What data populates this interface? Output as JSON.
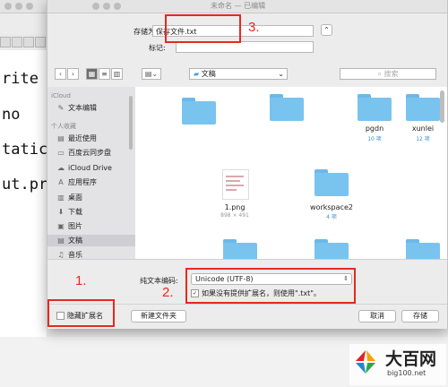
{
  "background_window": {
    "title": "未命名 — 已编辑",
    "toolbar_icons": [
      "format-square-icon",
      "format-square-icon",
      "format-square-icon",
      "format-square-icon"
    ],
    "code_lines": [
      "rite",
      "no",
      "tatic",
      "ut.pri"
    ]
  },
  "dialog": {
    "save_as_label": "存储为:",
    "save_as_value": "保存文件.txt",
    "tags_label": "标记:",
    "tags_value": "",
    "location": "文稿",
    "search_placeholder": "搜索",
    "view_modes": [
      "icon-view",
      "list-view",
      "column-view",
      "gallery-view"
    ],
    "sidebar": {
      "sections": [
        {
          "header": "iCloud",
          "items": [
            {
              "label": "文本编辑",
              "icon": "textedit-icon"
            }
          ]
        },
        {
          "header": "个人收藏",
          "items": [
            {
              "label": "最近使用",
              "icon": "recents-icon"
            },
            {
              "label": "百度云同步盘",
              "icon": "folder-icon"
            },
            {
              "label": "iCloud Drive",
              "icon": "cloud-icon"
            },
            {
              "label": "应用程序",
              "icon": "applications-icon"
            },
            {
              "label": "桌面",
              "icon": "desktop-icon"
            },
            {
              "label": "下载",
              "icon": "downloads-icon"
            },
            {
              "label": "图片",
              "icon": "pictures-icon"
            },
            {
              "label": "文稿",
              "icon": "documents-icon",
              "selected": true
            },
            {
              "label": "音乐",
              "icon": "music-icon"
            }
          ]
        }
      ]
    },
    "files": [
      {
        "name": "",
        "meta": "",
        "type": "folder"
      },
      {
        "name": "",
        "meta": "",
        "type": "folder"
      },
      {
        "name": "pgdn",
        "meta": "10 项",
        "type": "folder"
      },
      {
        "name": "xunlei",
        "meta": "12 项",
        "type": "folder"
      },
      {
        "name": "1.png",
        "meta": "898 × 491",
        "type": "image"
      },
      {
        "name": "workspace2",
        "meta": "4 项",
        "type": "folder"
      },
      {
        "name": "",
        "meta": "",
        "type": "folder"
      },
      {
        "name": "",
        "meta": "",
        "type": "folder"
      },
      {
        "name": "",
        "meta": "",
        "type": "folder"
      }
    ],
    "encoding_label": "纯文本编码:",
    "encoding_value": "Unicode (UTF-8)",
    "extension_checkbox_label": "如果没有提供扩展名，则使用\".txt\"。",
    "extension_checkbox_checked": true,
    "hide_extension_label": "隐藏扩展名",
    "hide_extension_checked": false,
    "new_folder_button": "新建文件夹",
    "cancel_button": "取消",
    "save_button": "存储"
  },
  "annotations": {
    "step1": "1.",
    "step2": "2.",
    "step3": "3.",
    "color": "#e8281e"
  },
  "watermark": {
    "title": "大百网",
    "site": "big100.net"
  }
}
